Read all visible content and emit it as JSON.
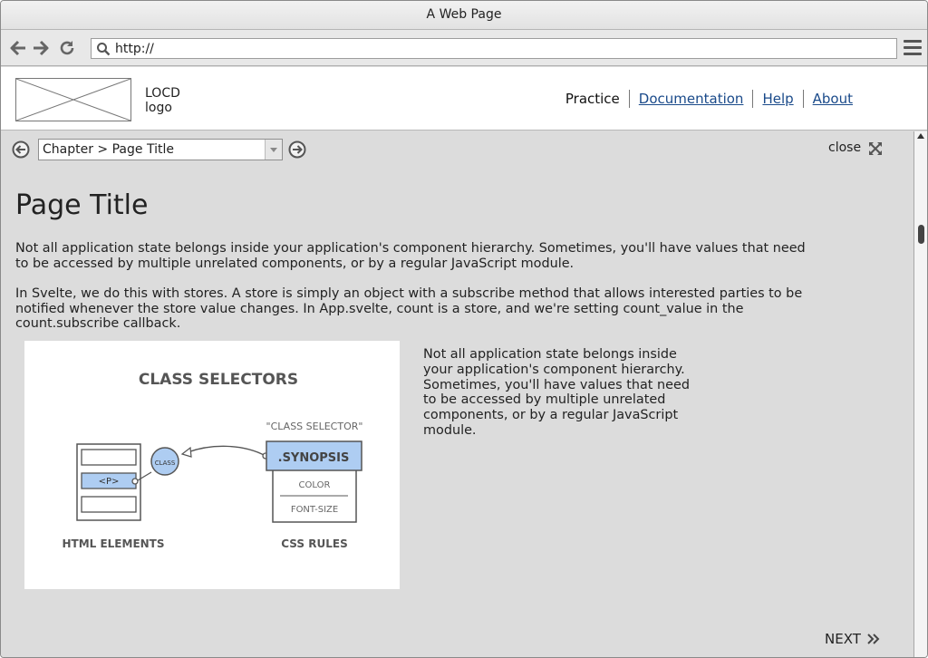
{
  "window": {
    "title": "A Web Page"
  },
  "toolbar": {
    "back_icon": "arrow-left-icon",
    "forward_icon": "arrow-right-icon",
    "reload_icon": "reload-icon",
    "url": "http://",
    "search_icon": "search-icon",
    "menu_icon": "hamburger-menu-icon"
  },
  "header": {
    "logo_line1": "LOCD",
    "logo_line2": "logo",
    "nav": [
      {
        "label": "Practice"
      },
      {
        "label": "Documentation"
      },
      {
        "label": "Help"
      },
      {
        "label": "About"
      }
    ]
  },
  "chapter_bar": {
    "prev_icon": "circle-arrow-left-icon",
    "next_icon": "circle-arrow-right-icon",
    "selected": "Chapter > Page Title",
    "close_label": "close",
    "expand_icon": "expand-icon"
  },
  "page": {
    "title": "Page Title",
    "paragraphs": [
      "Not all application state belongs inside your application's component hierarchy. Sometimes, you'll have values that need to be accessed by multiple unrelated components, or by a regular JavaScript module.",
      "In Svelte, we do this with stores. A store is simply an object with a subscribe method that allows interested parties to be notified whenever the store value changes. In App.svelte, count is a store, and we're setting count_value in the count.subscribe callback."
    ],
    "side_text": "Not all application state belongs inside your application's component hierarchy. Sometimes, you'll have values that need to be accessed by multiple unrelated components, or by a regular JavaScript module.",
    "next_label": "NEXT"
  },
  "diagram": {
    "title": "CLASS SELECTORS",
    "class_selector_label": "\"CLASS SELECTOR\"",
    "synopsis": ".SYNOPSIS",
    "color": "COLOR",
    "font_size": "FONT-SIZE",
    "p_tag": "<P>",
    "class_bubble": "CLASS",
    "html_elements": "HTML ELEMENTS",
    "css_rules": "CSS RULES",
    "colors": {
      "highlight": "#aecdf2",
      "stroke": "#555555"
    }
  }
}
